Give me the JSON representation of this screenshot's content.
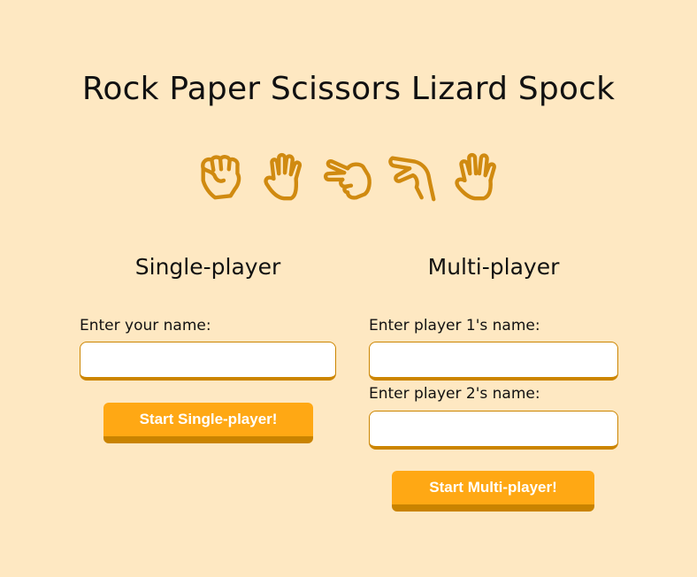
{
  "page": {
    "title": "Rock Paper Scissors Lizard Spock"
  },
  "hand_icons": [
    "rock-hand-icon",
    "paper-hand-icon",
    "scissors-hand-icon",
    "lizard-hand-icon",
    "spock-hand-icon"
  ],
  "colors": {
    "background": "#fee8c2",
    "accent": "#ffa814",
    "accent_dark": "#cc8500",
    "icon": "#d08a10"
  },
  "single": {
    "heading": "Single-player",
    "name_label": "Enter your name:",
    "name_value": "",
    "button_label": "Start Single-player!"
  },
  "multi": {
    "heading": "Multi-player",
    "player1_label": "Enter player 1's name:",
    "player1_value": "",
    "player2_label": "Enter player 2's name:",
    "player2_value": "",
    "button_label": "Start Multi-player!"
  }
}
